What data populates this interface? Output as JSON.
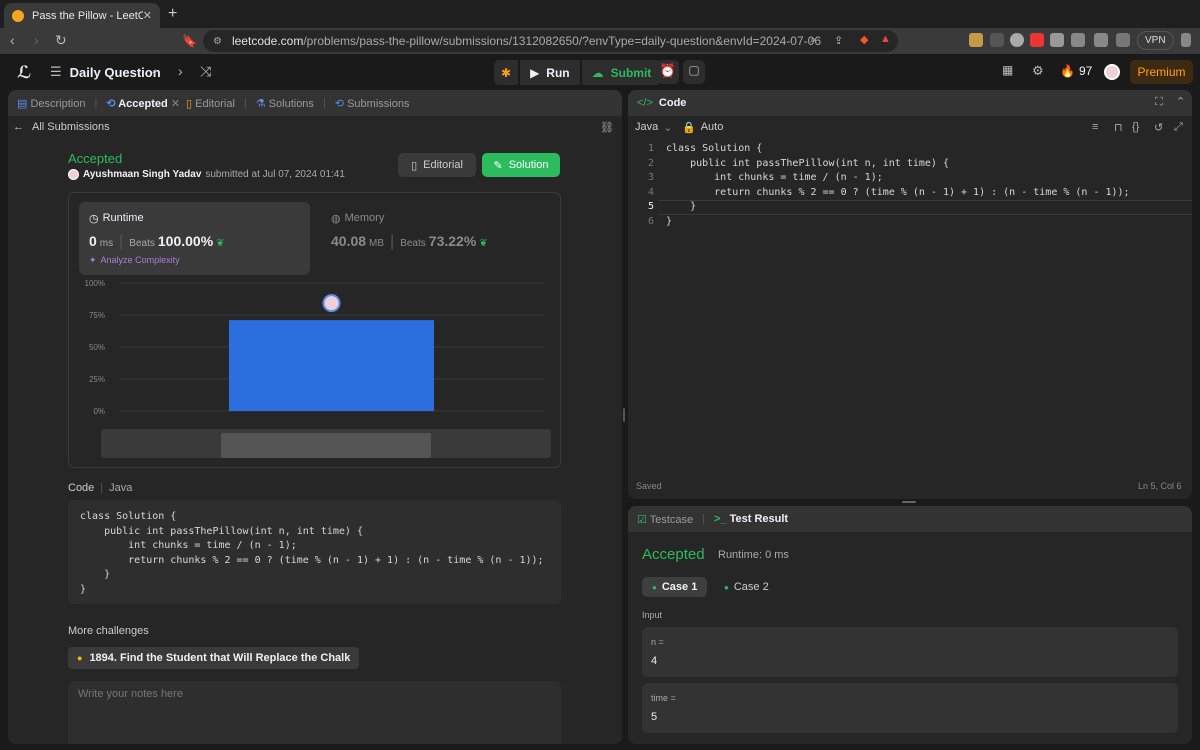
{
  "browser": {
    "tab_title": "Pass the Pillow - LeetCode",
    "url_host": "leetcode.com",
    "url_path": "/problems/pass-the-pillow/submissions/1312082650/?envType=daily-question&envId=2024-07-06",
    "vpn_label": "VPN"
  },
  "nav": {
    "daily_question": "Daily Question",
    "run": "Run",
    "submit": "Submit",
    "streak": "97",
    "premium": "Premium"
  },
  "left_tabs": [
    "Description",
    "Accepted",
    "Editorial",
    "Solutions",
    "Submissions"
  ],
  "submission": {
    "back_label": "All Submissions",
    "status": "Accepted",
    "author": "Ayushmaan Singh Yadav",
    "submitted_at": "submitted at Jul 07, 2024 01:41",
    "editorial_btn": "Editorial",
    "solution_btn": "Solution",
    "runtime_label": "Runtime",
    "runtime_value": "0",
    "runtime_unit": "ms",
    "beats_label": "Beats",
    "runtime_beats": "100.00%",
    "analyze": "Analyze Complexity",
    "memory_label": "Memory",
    "memory_value": "40.08",
    "memory_unit": "MB",
    "memory_beats": "73.22%"
  },
  "chart_data": {
    "type": "bar",
    "y_ticks": [
      "100%",
      "75%",
      "50%",
      "25%",
      "0%"
    ],
    "ylim": [
      0,
      100
    ],
    "values": [
      71
    ],
    "highlight_index": 0,
    "grid": true
  },
  "code_section": {
    "label": "Code",
    "lang": "Java",
    "lines": [
      "class Solution {",
      "    public int passThePillow(int n, int time) {",
      "        int chunks = time / (n - 1);",
      "        return chunks % 2 == 0 ? (time % (n - 1) + 1) : (n - time % (n - 1));",
      "    }",
      "}"
    ]
  },
  "more": {
    "label": "More challenges",
    "item": "1894. Find the Student that Will Replace the Chalk",
    "notes_placeholder": "Write your notes here"
  },
  "editor": {
    "title": "Code",
    "lang": "Java",
    "mode": "Auto",
    "line_numbers": [
      "1",
      "2",
      "3",
      "4",
      "5",
      "6"
    ],
    "saved": "Saved",
    "cursor": "Ln 5, Col 6"
  },
  "test": {
    "tab_testcase": "Testcase",
    "tab_result": "Test Result",
    "status": "Accepted",
    "runtime": "Runtime: 0 ms",
    "case1": "Case 1",
    "case2": "Case 2",
    "input_label": "Input",
    "n_label": "n =",
    "n_value": "4",
    "time_label": "time =",
    "time_value": "5"
  },
  "colors": {
    "accent_green": "#2cbb5d",
    "bar_blue": "#2a6ee0",
    "premium_orange": "#ffa116"
  }
}
